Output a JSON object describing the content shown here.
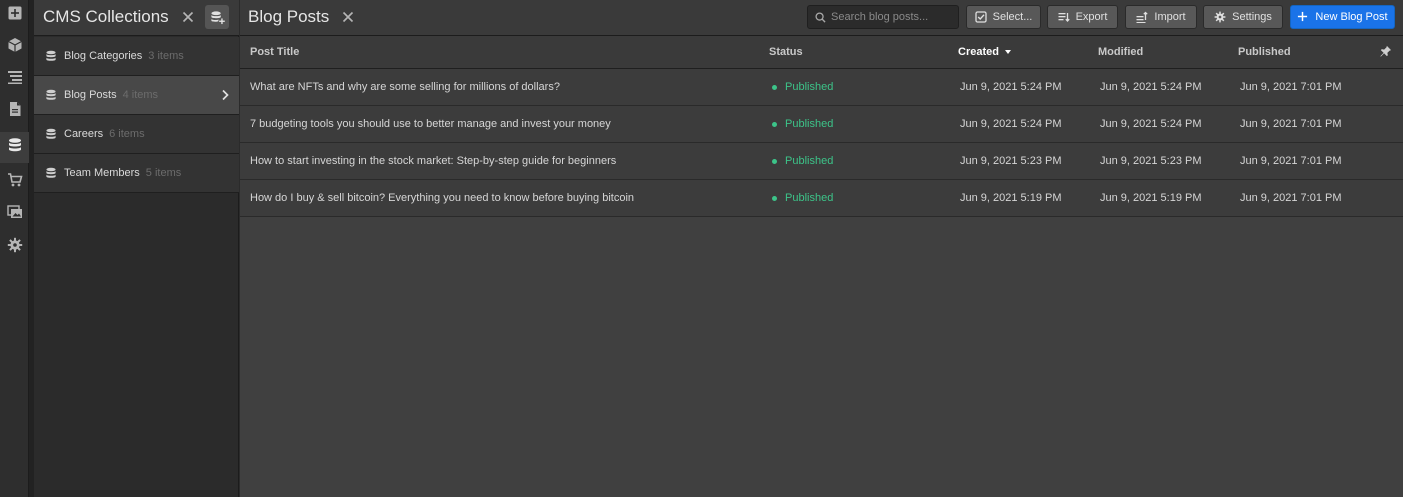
{
  "rail": {
    "items": [
      {
        "icon": "plus-square-icon"
      },
      {
        "icon": "cube-icon"
      },
      {
        "icon": "navigator-icon"
      },
      {
        "icon": "pages-icon"
      },
      {
        "icon": "cms-database-icon",
        "active": true
      },
      {
        "icon": "ecommerce-cart-icon"
      },
      {
        "icon": "assets-images-icon"
      },
      {
        "icon": "settings-gear-icon"
      }
    ]
  },
  "collections": {
    "title": "CMS Collections",
    "items": [
      {
        "name": "Blog Categories",
        "count": "3 items"
      },
      {
        "name": "Blog Posts",
        "count": "4 items",
        "active": true
      },
      {
        "name": "Careers",
        "count": "6 items"
      },
      {
        "name": "Team Members",
        "count": "5 items"
      }
    ]
  },
  "main": {
    "title": "Blog Posts",
    "search_placeholder": "Search blog posts...",
    "toolbar": {
      "select_label": "Select...",
      "export_label": "Export",
      "import_label": "Import",
      "settings_label": "Settings",
      "new_label": "New Blog Post"
    },
    "columns": {
      "title": "Post Title",
      "status": "Status",
      "created": "Created",
      "modified": "Modified",
      "published": "Published"
    },
    "rows": [
      {
        "title": "What are NFTs and why are some selling for millions of dollars?",
        "status": "Published",
        "created": "Jun 9, 2021 5:24 PM",
        "modified": "Jun 9, 2021 5:24 PM",
        "published": "Jun 9, 2021 7:01 PM"
      },
      {
        "title": "7 budgeting tools you should use to better manage and invest your money",
        "status": "Published",
        "created": "Jun 9, 2021 5:24 PM",
        "modified": "Jun 9, 2021 5:24 PM",
        "published": "Jun 9, 2021 7:01 PM"
      },
      {
        "title": "How to start investing in the stock market: Step-by-step guide for beginners",
        "status": "Published",
        "created": "Jun 9, 2021 5:23 PM",
        "modified": "Jun 9, 2021 5:23 PM",
        "published": "Jun 9, 2021 7:01 PM"
      },
      {
        "title": "How do I buy & sell bitcoin? Everything you need to know before buying bitcoin",
        "status": "Published",
        "created": "Jun 9, 2021 5:19 PM",
        "modified": "Jun 9, 2021 5:19 PM",
        "published": "Jun 9, 2021 7:01 PM"
      }
    ]
  },
  "colors": {
    "accent": "#1a73e8",
    "status_published": "#3cc489"
  }
}
